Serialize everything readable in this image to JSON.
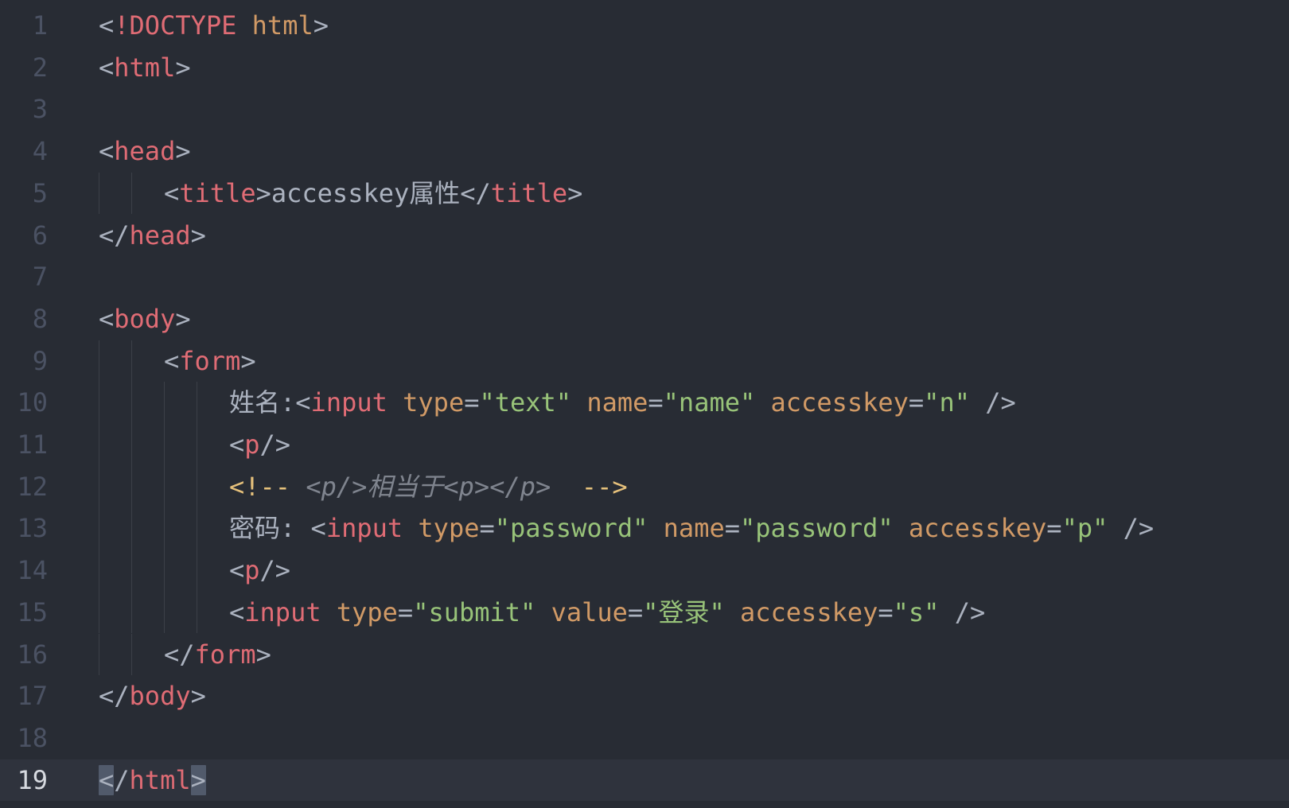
{
  "editor": {
    "theme_colors": {
      "background": "#282c34",
      "current_line": "#2f333d",
      "gutter": "#4b5263",
      "gutter_active": "#d7dae0",
      "punct": "#abb2bf",
      "tag": "#e06c75",
      "attr": "#d19a66",
      "string": "#98c379",
      "comment": "#7f848e",
      "comment_delim": "#e5c07b",
      "doctype": "#d19a66"
    },
    "current_line": 19,
    "lines": [
      {
        "num": "1",
        "indent": 0,
        "tokens": [
          {
            "t": "<",
            "c": "punct"
          },
          {
            "t": "!DOCTYPE",
            "c": "tag"
          },
          {
            "t": " html",
            "c": "doctype"
          },
          {
            "t": ">",
            "c": "punct"
          }
        ]
      },
      {
        "num": "2",
        "indent": 0,
        "tokens": [
          {
            "t": "<",
            "c": "punct"
          },
          {
            "t": "html",
            "c": "tag"
          },
          {
            "t": ">",
            "c": "punct"
          }
        ]
      },
      {
        "num": "3",
        "indent": 0,
        "tokens": []
      },
      {
        "num": "4",
        "indent": 0,
        "tokens": [
          {
            "t": "<",
            "c": "punct"
          },
          {
            "t": "head",
            "c": "tag"
          },
          {
            "t": ">",
            "c": "punct"
          }
        ]
      },
      {
        "num": "5",
        "indent": 1,
        "tokens": [
          {
            "t": "<",
            "c": "punct"
          },
          {
            "t": "title",
            "c": "tag"
          },
          {
            "t": ">",
            "c": "punct"
          },
          {
            "t": "accesskey属性",
            "c": "punct"
          },
          {
            "t": "</",
            "c": "punct"
          },
          {
            "t": "title",
            "c": "tag"
          },
          {
            "t": ">",
            "c": "punct"
          }
        ]
      },
      {
        "num": "6",
        "indent": 0,
        "tokens": [
          {
            "t": "</",
            "c": "punct"
          },
          {
            "t": "head",
            "c": "tag"
          },
          {
            "t": ">",
            "c": "punct"
          }
        ]
      },
      {
        "num": "7",
        "indent": 0,
        "tokens": []
      },
      {
        "num": "8",
        "indent": 0,
        "tokens": [
          {
            "t": "<",
            "c": "punct"
          },
          {
            "t": "body",
            "c": "tag"
          },
          {
            "t": ">",
            "c": "punct"
          }
        ]
      },
      {
        "num": "9",
        "indent": 1,
        "tokens": [
          {
            "t": "<",
            "c": "punct"
          },
          {
            "t": "form",
            "c": "tag"
          },
          {
            "t": ">",
            "c": "punct"
          }
        ]
      },
      {
        "num": "10",
        "indent": 2,
        "tokens": [
          {
            "t": "姓名:",
            "c": "punct"
          },
          {
            "t": "<",
            "c": "punct"
          },
          {
            "t": "input",
            "c": "tag"
          },
          {
            "t": " type",
            "c": "attr"
          },
          {
            "t": "=",
            "c": "punct"
          },
          {
            "t": "\"text\"",
            "c": "string"
          },
          {
            "t": " name",
            "c": "attr"
          },
          {
            "t": "=",
            "c": "punct"
          },
          {
            "t": "\"name\"",
            "c": "string"
          },
          {
            "t": " accesskey",
            "c": "attr"
          },
          {
            "t": "=",
            "c": "punct"
          },
          {
            "t": "\"n\"",
            "c": "string"
          },
          {
            "t": " />",
            "c": "punct"
          }
        ]
      },
      {
        "num": "11",
        "indent": 2,
        "tokens": [
          {
            "t": "<",
            "c": "punct"
          },
          {
            "t": "p",
            "c": "tag"
          },
          {
            "t": "/>",
            "c": "punct"
          }
        ]
      },
      {
        "num": "12",
        "indent": 2,
        "tokens": [
          {
            "t": "<!--",
            "c": "comment_delim"
          },
          {
            "t": " <p/>相当于<p></p>  ",
            "c": "comment"
          },
          {
            "t": "-->",
            "c": "comment_delim"
          }
        ]
      },
      {
        "num": "13",
        "indent": 2,
        "tokens": [
          {
            "t": "密码: ",
            "c": "punct"
          },
          {
            "t": "<",
            "c": "punct"
          },
          {
            "t": "input",
            "c": "tag"
          },
          {
            "t": " type",
            "c": "attr"
          },
          {
            "t": "=",
            "c": "punct"
          },
          {
            "t": "\"password\"",
            "c": "string"
          },
          {
            "t": " name",
            "c": "attr"
          },
          {
            "t": "=",
            "c": "punct"
          },
          {
            "t": "\"password\"",
            "c": "string"
          },
          {
            "t": " accesskey",
            "c": "attr"
          },
          {
            "t": "=",
            "c": "punct"
          },
          {
            "t": "\"p\"",
            "c": "string"
          },
          {
            "t": " />",
            "c": "punct"
          }
        ]
      },
      {
        "num": "14",
        "indent": 2,
        "tokens": [
          {
            "t": "<",
            "c": "punct"
          },
          {
            "t": "p",
            "c": "tag"
          },
          {
            "t": "/>",
            "c": "punct"
          }
        ]
      },
      {
        "num": "15",
        "indent": 2,
        "tokens": [
          {
            "t": "<",
            "c": "punct"
          },
          {
            "t": "input",
            "c": "tag"
          },
          {
            "t": " type",
            "c": "attr"
          },
          {
            "t": "=",
            "c": "punct"
          },
          {
            "t": "\"submit\"",
            "c": "string"
          },
          {
            "t": " value",
            "c": "attr"
          },
          {
            "t": "=",
            "c": "punct"
          },
          {
            "t": "\"登录\"",
            "c": "string"
          },
          {
            "t": " accesskey",
            "c": "attr"
          },
          {
            "t": "=",
            "c": "punct"
          },
          {
            "t": "\"s\"",
            "c": "string"
          },
          {
            "t": " />",
            "c": "punct"
          }
        ]
      },
      {
        "num": "16",
        "indent": 1,
        "tokens": [
          {
            "t": "</",
            "c": "punct"
          },
          {
            "t": "form",
            "c": "tag"
          },
          {
            "t": ">",
            "c": "punct"
          }
        ]
      },
      {
        "num": "17",
        "indent": 0,
        "tokens": [
          {
            "t": "</",
            "c": "punct"
          },
          {
            "t": "body",
            "c": "tag"
          },
          {
            "t": ">",
            "c": "punct"
          }
        ]
      },
      {
        "num": "18",
        "indent": 0,
        "tokens": []
      },
      {
        "num": "19",
        "indent": 0,
        "tokens": [
          {
            "t": "<",
            "c": "punct",
            "m": true
          },
          {
            "t": "/",
            "c": "punct"
          },
          {
            "t": "html",
            "c": "tag"
          },
          {
            "t": ">",
            "c": "punct",
            "m": true
          }
        ]
      }
    ]
  }
}
